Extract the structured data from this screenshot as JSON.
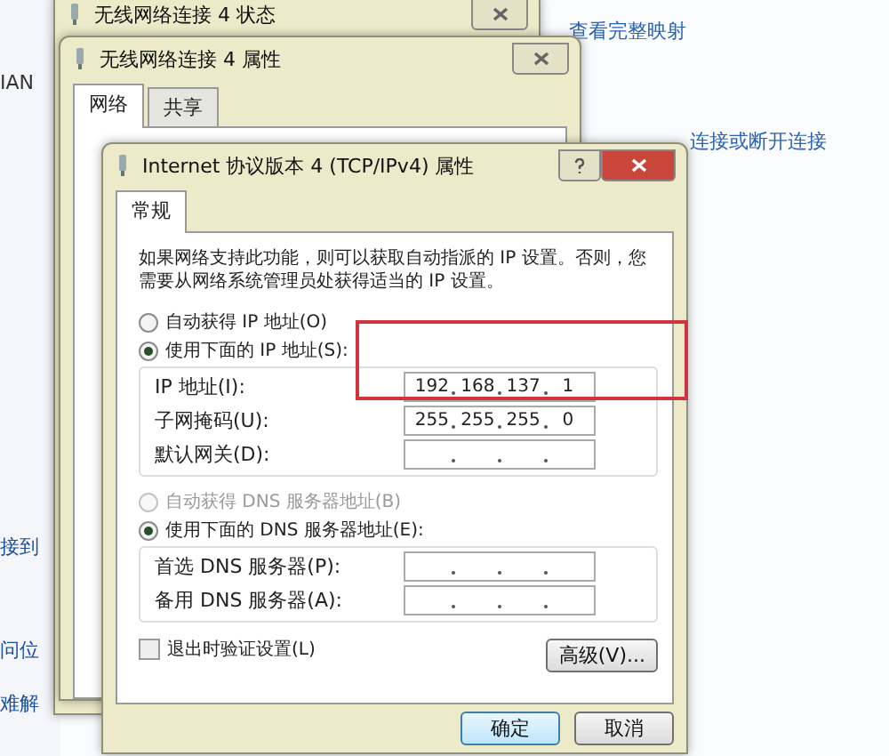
{
  "background_page": {
    "links": [
      {
        "text": "查看完整映射"
      },
      {
        "text": "连接或断开连接"
      }
    ],
    "side_fragments": [
      {
        "text": "IAN"
      },
      {
        "text": "接到"
      },
      {
        "text": "问位"
      },
      {
        "text": "难解"
      }
    ]
  },
  "status_window": {
    "title": "无线网络连接 4 状态"
  },
  "properties_window": {
    "title": "无线网络连接 4 属性",
    "tabs": [
      {
        "label": "网络",
        "selected": true
      },
      {
        "label": "共享",
        "selected": false
      }
    ]
  },
  "ipv4_dialog": {
    "title": "Internet 协议版本 4 (TCP/IPv4) 属性",
    "tabs": [
      {
        "label": "常规",
        "selected": true
      }
    ],
    "description": "如果网络支持此功能，则可以获取自动指派的 IP 设置。否则，您需要从网络系统管理员处获得适当的 IP 设置。",
    "ip_options": [
      {
        "label": "自动获得 IP 地址(O)",
        "selected": false,
        "disabled": false
      },
      {
        "label": "使用下面的 IP 地址(S):",
        "selected": true,
        "disabled": false
      }
    ],
    "ip_fields": [
      {
        "label": "IP 地址(I):",
        "octets": [
          "192",
          "168",
          "137",
          "1"
        ]
      },
      {
        "label": "子网掩码(U):",
        "octets": [
          "255",
          "255",
          "255",
          "0"
        ]
      },
      {
        "label": "默认网关(D):"
      }
    ],
    "dns_options": [
      {
        "label": "自动获得 DNS 服务器地址(B)",
        "selected": false,
        "disabled": true
      },
      {
        "label": "使用下面的 DNS 服务器地址(E):",
        "selected": true,
        "disabled": false
      }
    ],
    "dns_fields": [
      {
        "label": "首选 DNS 服务器(P):"
      },
      {
        "label": "备用 DNS 服务器(A):"
      }
    ],
    "validate_on_exit": {
      "label": "退出时验证设置(L)",
      "checked": false
    },
    "advanced_button": "高级(V)...",
    "buttons": [
      "确定",
      "取消"
    ]
  },
  "annotations": [
    {
      "kind": "rectangle"
    }
  ]
}
